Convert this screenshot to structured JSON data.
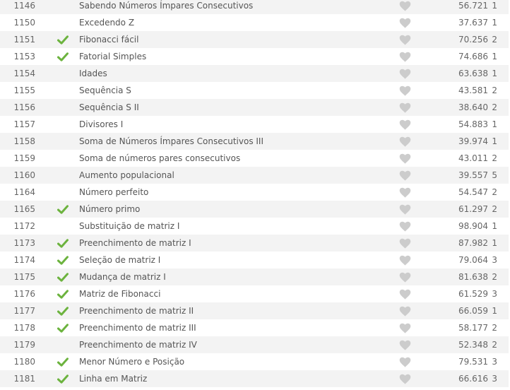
{
  "colors": {
    "check": "#6cb33e",
    "heart": "#cccccc",
    "row_stripe": "#f3f3f3"
  },
  "icons": {
    "solved": "check-icon",
    "favorite": "heart-icon"
  },
  "problems": [
    {
      "id": "1146",
      "name": "Sabendo Números Ímpares Consecutivos",
      "solved_by": "56.721",
      "level": "1",
      "completed": false
    },
    {
      "id": "1150",
      "name": "Excedendo Z",
      "solved_by": "37.637",
      "level": "1",
      "completed": false
    },
    {
      "id": "1151",
      "name": "Fibonacci fácil",
      "solved_by": "70.256",
      "level": "2",
      "completed": true
    },
    {
      "id": "1153",
      "name": "Fatorial Simples",
      "solved_by": "74.686",
      "level": "1",
      "completed": true
    },
    {
      "id": "1154",
      "name": "Idades",
      "solved_by": "63.638",
      "level": "1",
      "completed": false
    },
    {
      "id": "1155",
      "name": "Sequência S",
      "solved_by": "43.581",
      "level": "2",
      "completed": false
    },
    {
      "id": "1156",
      "name": "Sequência S II",
      "solved_by": "38.640",
      "level": "2",
      "completed": false
    },
    {
      "id": "1157",
      "name": "Divisores I",
      "solved_by": "54.883",
      "level": "1",
      "completed": false
    },
    {
      "id": "1158",
      "name": "Soma de Números Ímpares Consecutivos III",
      "solved_by": "39.974",
      "level": "1",
      "completed": false
    },
    {
      "id": "1159",
      "name": "Soma de números pares consecutivos",
      "solved_by": "43.011",
      "level": "2",
      "completed": false
    },
    {
      "id": "1160",
      "name": "Aumento populacional",
      "solved_by": "39.557",
      "level": "5",
      "completed": false
    },
    {
      "id": "1164",
      "name": "Número perfeito",
      "solved_by": "54.547",
      "level": "2",
      "completed": false
    },
    {
      "id": "1165",
      "name": "Número primo",
      "solved_by": "61.297",
      "level": "2",
      "completed": true
    },
    {
      "id": "1172",
      "name": "Substituição de matriz I",
      "solved_by": "98.904",
      "level": "1",
      "completed": false
    },
    {
      "id": "1173",
      "name": "Preenchimento de matriz I",
      "solved_by": "87.982",
      "level": "1",
      "completed": true
    },
    {
      "id": "1174",
      "name": "Seleção de matriz I",
      "solved_by": "79.064",
      "level": "3",
      "completed": true
    },
    {
      "id": "1175",
      "name": "Mudança de matriz I",
      "solved_by": "81.638",
      "level": "2",
      "completed": true
    },
    {
      "id": "1176",
      "name": "Matriz de Fibonacci",
      "solved_by": "61.529",
      "level": "3",
      "completed": true
    },
    {
      "id": "1177",
      "name": "Preenchimento de matriz II",
      "solved_by": "66.059",
      "level": "1",
      "completed": true
    },
    {
      "id": "1178",
      "name": "Preenchimento de matriz III",
      "solved_by": "58.177",
      "level": "2",
      "completed": true
    },
    {
      "id": "1179",
      "name": "Preenchimento de matriz IV",
      "solved_by": "52.348",
      "level": "2",
      "completed": false
    },
    {
      "id": "1180",
      "name": "Menor Número e Posição",
      "solved_by": "79.531",
      "level": "3",
      "completed": true
    },
    {
      "id": "1181",
      "name": "Linha em Matriz",
      "solved_by": "66.616",
      "level": "3",
      "completed": true
    }
  ]
}
